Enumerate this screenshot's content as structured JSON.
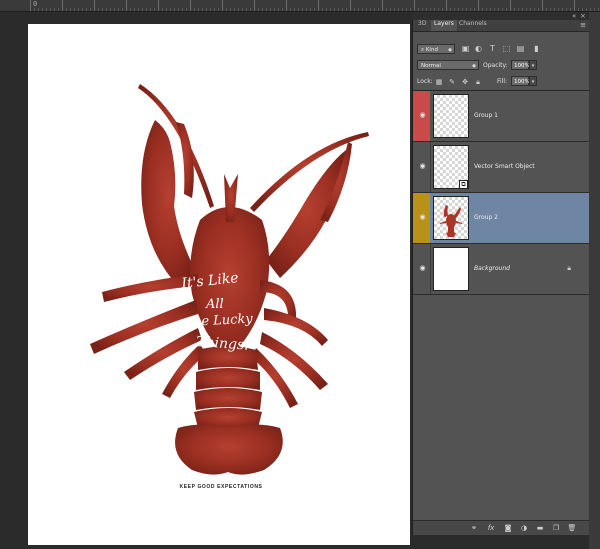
{
  "ruler": {
    "labels": [
      "0",
      "",
      "",
      "",
      "",
      "",
      "",
      "",
      "",
      "",
      "",
      ""
    ]
  },
  "artwork": {
    "text_lines": [
      "It's Like",
      "All",
      "the Lucky",
      "Things."
    ],
    "tagline": "KEEP GOOD EXPECTATIONS",
    "lobster_color": "#a93526"
  },
  "panel": {
    "tabs": [
      "3D",
      "Layers",
      "Channels"
    ],
    "active_tab": "Layers",
    "menu_icon": "panel-menu-icon",
    "filter": {
      "kind_label": "⌕ Kind",
      "icons": [
        "image-filter-icon",
        "adjustment-filter-icon",
        "type-filter-icon",
        "shape-filter-icon",
        "smart-object-filter-icon",
        "filter-toggle-icon"
      ]
    },
    "blend_mode": "Normal",
    "opacity_label": "Opacity:",
    "opacity_value": "100%",
    "lock_label": "Lock:",
    "fill_label": "Fill:",
    "fill_value": "100%",
    "lock_icons": [
      "lock-transparent-icon",
      "lock-paint-icon",
      "lock-position-icon",
      "lock-all-icon"
    ],
    "layers": [
      {
        "name": "Group 1",
        "color_tag": "#c84a4a",
        "thumb": "transparent",
        "selected": false,
        "italic": false
      },
      {
        "name": "Vector Smart Object",
        "color_tag": "",
        "thumb": "transparent",
        "selected": false,
        "italic": false
      },
      {
        "name": "Group 2",
        "color_tag": "#b8901a",
        "thumb": "lobster",
        "selected": true,
        "italic": false
      },
      {
        "name": "Background",
        "color_tag": "",
        "thumb": "white",
        "selected": false,
        "italic": true
      }
    ],
    "bottom_icons": [
      "link-layers-icon",
      "fx-icon",
      "add-mask-icon",
      "adjustment-layer-icon",
      "new-group-icon",
      "new-layer-icon",
      "trash-icon"
    ]
  }
}
